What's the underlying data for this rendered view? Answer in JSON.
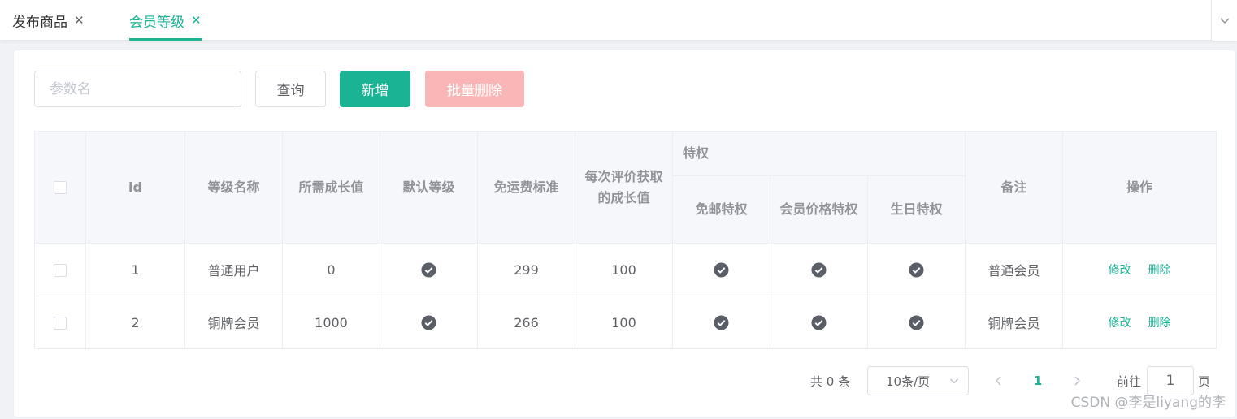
{
  "tabs": [
    {
      "label": "发布商品",
      "active": false
    },
    {
      "label": "会员等级",
      "active": true
    }
  ],
  "tab_close_glyph": "✕",
  "toolbar": {
    "search_placeholder": "参数名",
    "query_label": "查询",
    "add_label": "新增",
    "batch_delete_label": "批量删除"
  },
  "table": {
    "headers": {
      "id": "id",
      "name": "等级名称",
      "growth_required": "所需成长值",
      "default_level": "默认等级",
      "free_shipping_threshold": "免运费标准",
      "growth_per_review": "每次评价获取的成长值",
      "privileges": "特权",
      "free_shipping_privilege": "免邮特权",
      "member_price_privilege": "会员价格特权",
      "birthday_privilege": "生日特权",
      "remark": "备注",
      "actions": "操作"
    },
    "rows": [
      {
        "id": "1",
        "name": "普通用户",
        "growth_required": "0",
        "default_level": true,
        "free_shipping_threshold": "299",
        "growth_per_review": "100",
        "free_shipping_privilege": true,
        "member_price_privilege": true,
        "birthday_privilege": true,
        "remark": "普通会员"
      },
      {
        "id": "2",
        "name": "铜牌会员",
        "growth_required": "1000",
        "default_level": true,
        "free_shipping_threshold": "266",
        "growth_per_review": "100",
        "free_shipping_privilege": true,
        "member_price_privilege": true,
        "birthday_privilege": true,
        "remark": "铜牌会员"
      }
    ],
    "edit_label": "修改",
    "delete_label": "删除"
  },
  "pagination": {
    "total_text": "共 0 条",
    "page_size_text": "10条/页",
    "current_page": "1",
    "goto_label": "前往",
    "goto_value": "1",
    "page_suffix": "页"
  },
  "watermark": "CSDN @李是liyang的李",
  "colors": {
    "primary": "#1ab394",
    "danger_disabled": "#fab6b6",
    "header_bg": "#f5f7fa",
    "check_icon": "#5a5e66"
  },
  "icons": {
    "check": "check-circle-icon",
    "close": "close-icon",
    "dropdown": "chevron-down-icon",
    "prev": "chevron-left-icon",
    "next": "chevron-right-icon"
  }
}
